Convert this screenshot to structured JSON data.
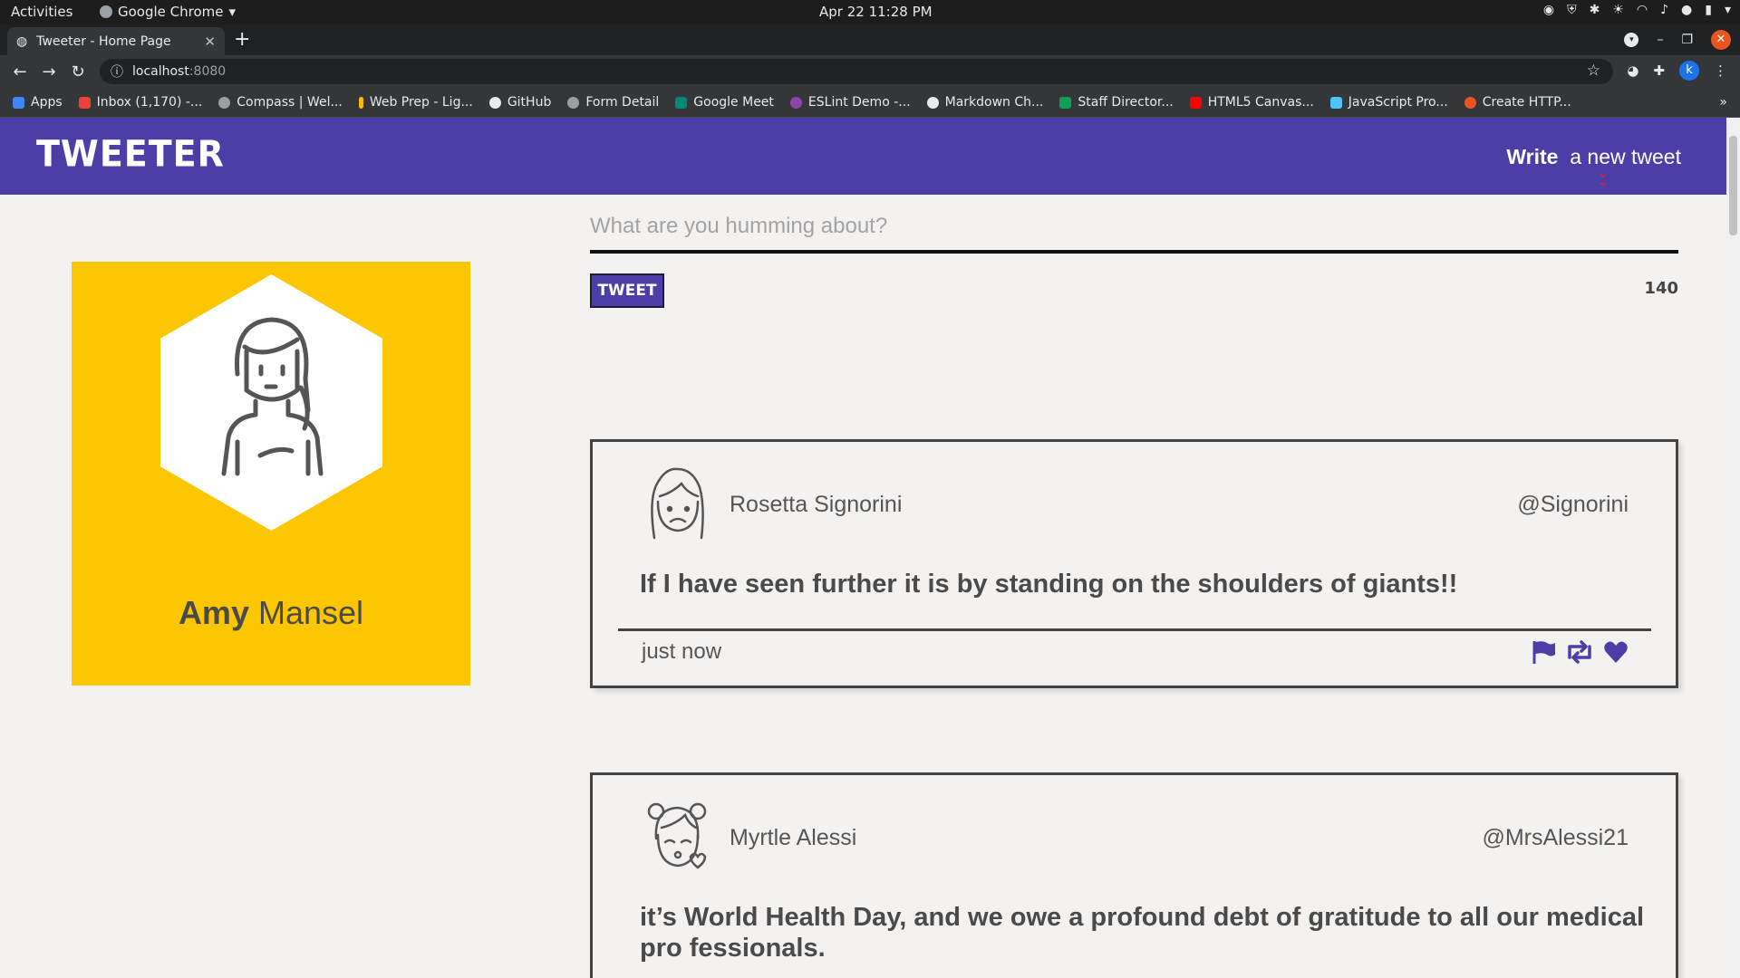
{
  "os_bar": {
    "activities": "Activities",
    "app_name": "Google Chrome",
    "clock": "Apr 22  11:28 PM"
  },
  "browser": {
    "tab_title": "Tweeter - Home Page",
    "url_host": "localhost",
    "url_port": ":8080",
    "profile_initial": "k",
    "bookmarks": [
      {
        "label": "Apps",
        "color": "#4285f4"
      },
      {
        "label": "Inbox (1,170) -...",
        "color": "#ea4335"
      },
      {
        "label": "Compass | Wel...",
        "color": "#9aa0a6"
      },
      {
        "label": "Web Prep - Lig...",
        "color": "#fbbc04"
      },
      {
        "label": "GitHub",
        "color": "#e8eaed"
      },
      {
        "label": "Form Detail",
        "color": "#9aa0a6"
      },
      {
        "label": "Google Meet",
        "color": "#00897b"
      },
      {
        "label": "ESLint Demo -...",
        "color": "#8e44ad"
      },
      {
        "label": "Markdown Ch...",
        "color": "#e8eaed"
      },
      {
        "label": "Staff Director...",
        "color": "#0f9d58"
      },
      {
        "label": "HTML5 Canvas...",
        "color": "#ff0000"
      },
      {
        "label": "JavaScript Pro...",
        "color": "#4fc3f7"
      },
      {
        "label": "Create HTTP...",
        "color": "#e95420"
      }
    ]
  },
  "app": {
    "logo": "TWEETER",
    "write_bold": "Write",
    "write_rest": "a new tweet",
    "brand_color": "#4b3ea6",
    "profile": {
      "first_name": "Amy",
      "last_name": "Mansel",
      "card_color": "#fcc600"
    },
    "compose": {
      "placeholder": "What are you humming about?",
      "button": "TWEET",
      "counter": "140"
    },
    "tweets": [
      {
        "name": "Rosetta Signorini",
        "handle": "@Signorini",
        "content": "If I have seen further it is by standing on the shoulders of giants!!",
        "time": "just now",
        "avatar_icon": "sad-girl-avatar-icon"
      },
      {
        "name": "Myrtle Alessi",
        "handle": "@MrsAlessi21",
        "content": "it’s World Health Day, and we owe a profound debt of gratitude to all our medical pro fessionals.",
        "time": "",
        "avatar_icon": "kiss-girl-avatar-icon"
      }
    ]
  }
}
